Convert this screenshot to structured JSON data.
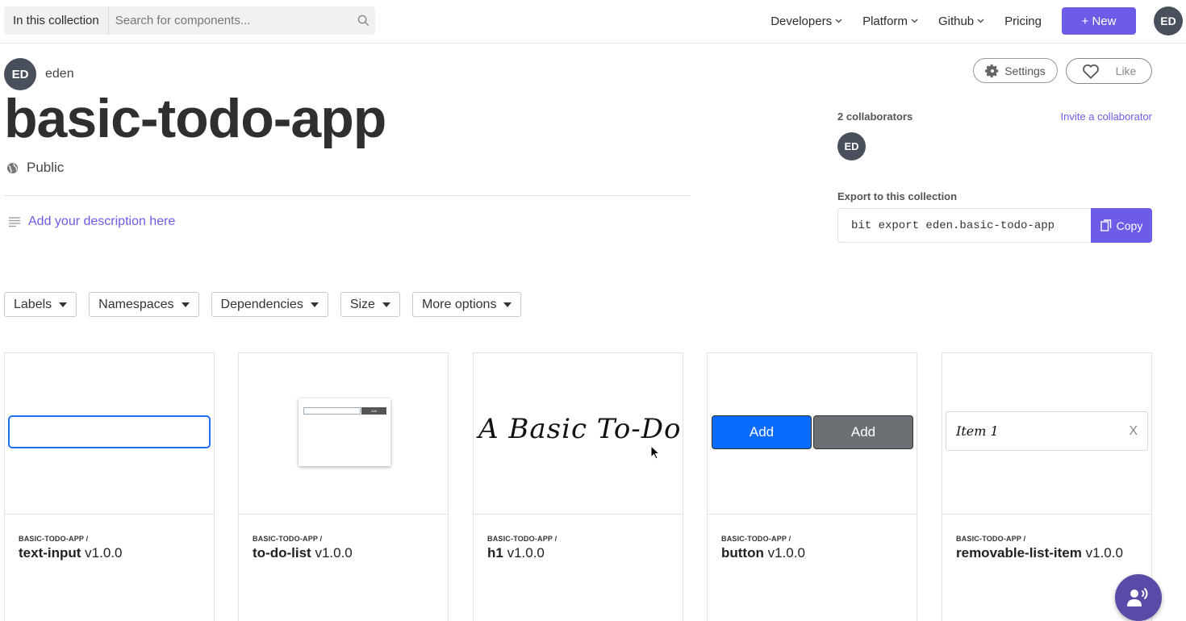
{
  "search": {
    "scope": "In this collection",
    "placeholder": "Search for components..."
  },
  "nav": {
    "developers": "Developers",
    "platform": "Platform",
    "github": "Github",
    "pricing": "Pricing",
    "new_label": "+ New",
    "user_initials": "ED"
  },
  "owner": {
    "initials": "ED",
    "name": "eden"
  },
  "collection": {
    "title": "basic-todo-app",
    "visibility": "Public",
    "description_prompt": "Add your description here"
  },
  "actions": {
    "settings": "Settings",
    "like": "Like"
  },
  "collaborators": {
    "label": "2 collaborators",
    "invite": "Invite a collaborator",
    "initials": "ED"
  },
  "export": {
    "label": "Export to this collection",
    "command": "bit export eden.basic-todo-app",
    "copy": "Copy"
  },
  "filters": [
    "Labels",
    "Namespaces",
    "Dependencies",
    "Size",
    "More options"
  ],
  "cards": [
    {
      "namespace": "BASIC-TODO-APP /",
      "name": "text-input",
      "version": "v1.0.0"
    },
    {
      "namespace": "BASIC-TODO-APP /",
      "name": "to-do-list",
      "version": "v1.0.0"
    },
    {
      "namespace": "BASIC-TODO-APP /",
      "name": "h1",
      "version": "v1.0.0"
    },
    {
      "namespace": "BASIC-TODO-APP /",
      "name": "button",
      "version": "v1.0.0"
    },
    {
      "namespace": "BASIC-TODO-APP /",
      "name": "removable-list-item",
      "version": "v1.0.0"
    }
  ],
  "previews": {
    "mini_add": "Add",
    "h1_text": "A Basic To-Do App",
    "button_blue": "Add",
    "button_gray": "Add",
    "list_item": "Item 1",
    "list_remove": "X"
  },
  "colors": {
    "accent": "#6c5ce7",
    "avatar": "#4a4f5c",
    "preview_blue": "#0a6cff"
  }
}
